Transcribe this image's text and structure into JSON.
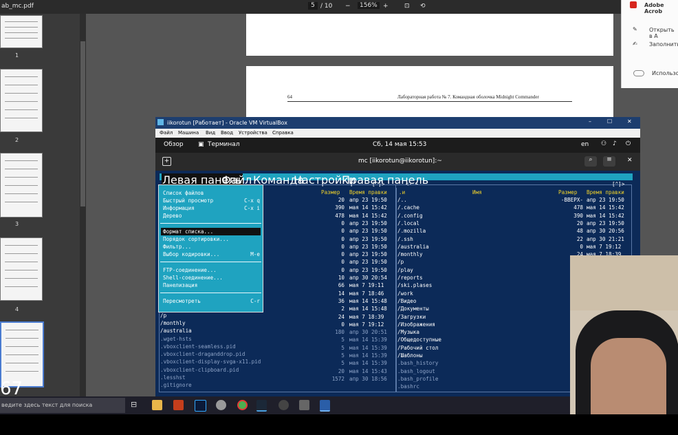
{
  "pdf_viewer": {
    "file_name": "ab_mc.pdf",
    "page_current": "5",
    "page_total": "/ 10",
    "zoom": "156%",
    "zoom_out_icon": "minus-icon",
    "zoom_in_icon": "plus-icon",
    "fit_icon": "fit-page-icon",
    "rotate_icon": "rotate-icon",
    "thumbnail_numbers": [
      "1",
      "2",
      "3",
      "4"
    ],
    "big_number": "67",
    "page_header_num": "64",
    "page_header_title": "Лабораторная работа № 7. Командная оболочка Midnight Commander"
  },
  "acrobat": {
    "title": "Adobe Acrob",
    "item_open": "Открыть в A",
    "item_fill": "Заполнить",
    "item_use": "Использов"
  },
  "vm": {
    "title": "iikorotun [Работает] - Oracle VM VirtualBox",
    "menu": [
      "Файл",
      "Машина",
      "Вид",
      "Ввод",
      "Устройства",
      "Справка"
    ],
    "min": "–",
    "max": "☐",
    "close": "✕"
  },
  "gnome": {
    "overview": "Обзор",
    "terminal": "Терминал",
    "clock": "Сб, 14 мая  15:53",
    "lang": "en"
  },
  "terminal": {
    "title": "mc [iikorotun@iikorotun]:~"
  },
  "mc": {
    "menu": [
      "Левая панель",
      "Файл",
      "Команда",
      "Настройки",
      "Правая панель"
    ],
    "left_headers": [
      "Размер",
      "Время правки"
    ],
    "right_top": "<- ~",
    "right_headers": [
      ".и",
      "Имя",
      "Размер",
      "Время правки"
    ],
    "bracket": "[^]>",
    "left_rows": [
      [
        "20",
        "апр 23 19:50"
      ],
      [
        "390",
        "мая 14 15:42"
      ],
      [
        "478",
        "мая 14 15:42"
      ],
      [
        "0",
        "апр 23 19:50"
      ],
      [
        "0",
        "апр 23 19:50"
      ],
      [
        "0",
        "апр 23 19:50"
      ],
      [
        "0",
        "апр 23 19:50"
      ],
      [
        "0",
        "апр 23 19:50"
      ],
      [
        "0",
        "апр 23 19:50"
      ],
      [
        "0",
        "апр 23 19:50"
      ],
      [
        "10",
        "апр 30 20:54"
      ],
      [
        "66",
        "мая  7 19:11"
      ],
      [
        "14",
        "мая  7 18:46"
      ],
      [
        "36",
        "мая 14 15:48"
      ],
      [
        "2",
        "мая 14 15:48"
      ],
      [
        "24",
        "мая  7 18:39"
      ],
      [
        "0",
        "мая  7 19:12"
      ],
      [
        "180",
        "апр 30 20:51"
      ],
      [
        "5",
        "мая 14 15:39"
      ],
      [
        "5",
        "мая 14 15:39"
      ],
      [
        "5",
        "мая 14 15:39"
      ],
      [
        "5",
        "мая 14 15:39"
      ],
      [
        "20",
        "мая 14 15:43"
      ],
      [
        "1572",
        "апр 30 18:56"
      ]
    ],
    "left_names": [
      "/p",
      "/monthly",
      "/australia",
      " .wget-hsts",
      " .vboxclient-seamless.pid",
      " .vboxclient-draganddrop.pid",
      " .vboxclient-display-svga-x11.pid",
      " .vboxclient-clipboard.pid",
      " .lesshst",
      " .gitignore"
    ],
    "right_rows": [
      [
        "/..",
        "-ВВЕРХ-",
        "апр 23 19:50"
      ],
      [
        "/.cache",
        "478",
        "мая 14 15:42"
      ],
      [
        "/.config",
        "390",
        "мая 14 15:42"
      ],
      [
        "/.local",
        "20",
        "апр 23 19:50"
      ],
      [
        "/.mozilla",
        "48",
        "апр 30 20:56"
      ],
      [
        "/.ssh",
        "22",
        "апр 30 21:21"
      ],
      [
        "/australia",
        "0",
        "мая  7 19:12"
      ],
      [
        "/monthly",
        "24",
        "мая  7 18:39"
      ],
      [
        "/p",
        "",
        ""
      ],
      [
        "/play",
        "",
        ""
      ],
      [
        "/reports",
        "",
        ""
      ],
      [
        "/ski.plases",
        "",
        ""
      ],
      [
        "/work",
        "",
        ""
      ],
      [
        "/Видео",
        "",
        ""
      ],
      [
        "/Документы",
        "",
        ""
      ],
      [
        "/Загрузки",
        "",
        ""
      ],
      [
        "/Изображения",
        "",
        ""
      ],
      [
        "/Музыка",
        "",
        ""
      ],
      [
        "/Общедоступные",
        "",
        ""
      ],
      [
        "/Рабочий стол",
        "",
        ""
      ],
      [
        "/Шаблоны",
        "",
        ""
      ],
      [
        " .bash_history",
        "",
        ""
      ],
      [
        " .bash_logout",
        "",
        ""
      ],
      [
        " .bash_profile",
        "",
        ""
      ],
      [
        " .bashrc",
        "",
        ""
      ]
    ],
    "dropdown": [
      {
        "label": "Список файлов",
        "key": ""
      },
      {
        "label": "Быстрый просмотр",
        "key": "C-x q"
      },
      {
        "label": "Информация",
        "key": "C-x i"
      },
      {
        "label": "Дерево",
        "key": ""
      },
      {
        "label": "Формат списка...",
        "key": ""
      },
      {
        "label": "Порядок сортировки...",
        "key": ""
      },
      {
        "label": "Фильтр...",
        "key": ""
      },
      {
        "label": "Выбор кодировки...",
        "key": "M-e"
      },
      {
        "label": "FTP-соединение...",
        "key": ""
      },
      {
        "label": "Shell-соединение...",
        "key": ""
      },
      {
        "label": "Панелизация",
        "key": ""
      },
      {
        "label": "Пересмотреть",
        "key": "C-r"
      }
    ]
  },
  "taskbar": {
    "search_placeholder": "ведите здесь текст для поиска"
  }
}
